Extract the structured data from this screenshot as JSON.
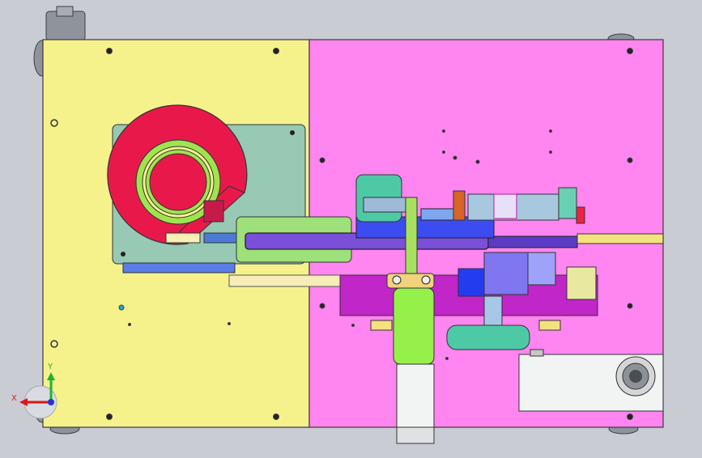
{
  "viewport": {
    "background": "#c9ccd3",
    "colors": {
      "left_plate": "#f5f28c",
      "right_plate": "#ff85f0",
      "red_disc": "#e8194a",
      "green_ring": "#9fe34f",
      "mount_plate": "#97c9b4",
      "purple_arm": "#7a4fd9",
      "blue_block": "#3c4cf0",
      "magenta_block": "#c026c8",
      "motor_green": "#96f04a",
      "teal_pad": "#4ec9a6",
      "cylinder_white": "#f2f3f3"
    }
  },
  "triad": {
    "x_label": "X",
    "y_label": "Y",
    "x_color": "#e01616",
    "y_color": "#1bb52f",
    "z_color": "#2333d8"
  }
}
